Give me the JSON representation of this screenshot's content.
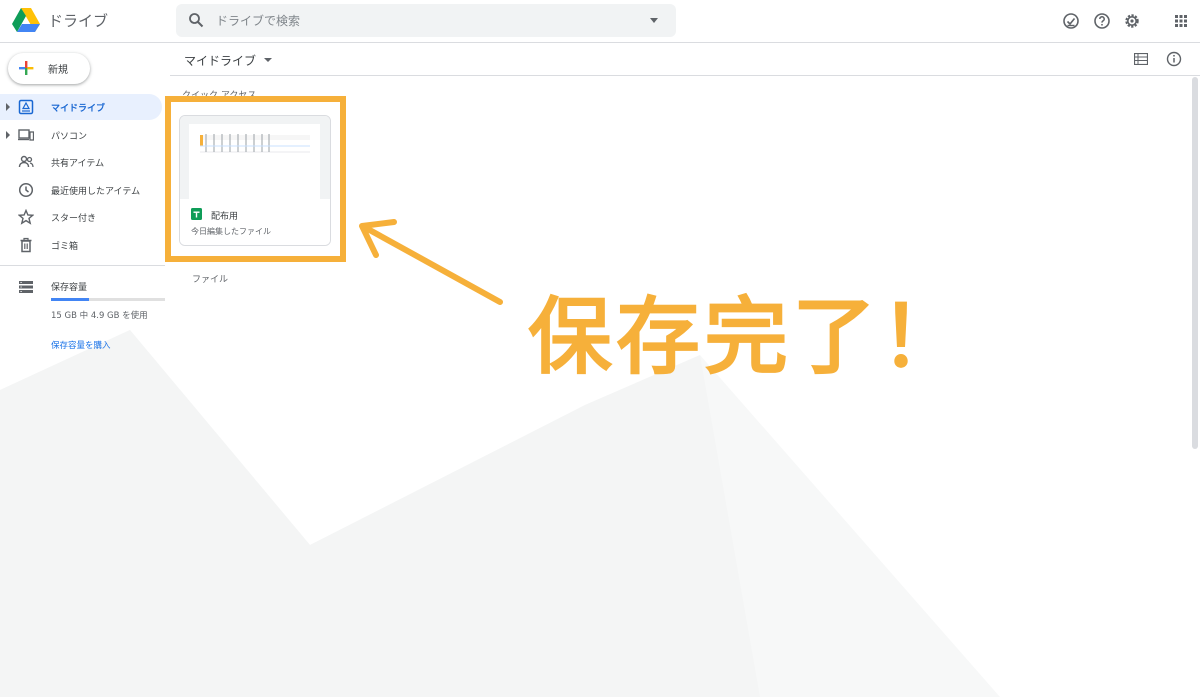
{
  "header": {
    "app_title": "ドライブ",
    "search": {
      "placeholder": "ドライブで検索",
      "value": ""
    },
    "icons": [
      "offline-ready-icon",
      "help-icon",
      "settings-icon",
      "apps-grid-icon"
    ]
  },
  "sidebar": {
    "new_label": "新規",
    "items": [
      {
        "label": "マイドライブ",
        "icon": "my-drive-icon",
        "active": true,
        "expandable": true
      },
      {
        "label": "パソコン",
        "icon": "computers-icon",
        "active": false,
        "expandable": true
      },
      {
        "label": "共有アイテム",
        "icon": "shared-with-me-icon",
        "active": false,
        "expandable": false
      },
      {
        "label": "最近使用したアイテム",
        "icon": "recent-clock-icon",
        "active": false,
        "expandable": false
      },
      {
        "label": "スター付き",
        "icon": "star-icon",
        "active": false,
        "expandable": false
      },
      {
        "label": "ゴミ箱",
        "icon": "trash-icon",
        "active": false,
        "expandable": false
      }
    ],
    "storage": {
      "label": "保存容量",
      "usage_text": "15 GB 中 4.9 GB を使用",
      "used_fraction": 0.33,
      "buy_label": "保存容量を購入"
    }
  },
  "main": {
    "breadcrumb": "マイドライブ",
    "quick_access_heading": "クイック アクセス",
    "quick_access_files": [
      {
        "name": "配布用",
        "meta": "今日編集したファイル",
        "type_icon": "google-sheets-icon"
      }
    ],
    "files_heading": "ファイル"
  },
  "annotation": {
    "callout_text": "保存完了！",
    "color": "#f6b03a"
  },
  "colors": {
    "accent_blue": "#1a73e8",
    "active_bg": "#e8f0fe",
    "annotation_orange": "#f6b03a"
  }
}
